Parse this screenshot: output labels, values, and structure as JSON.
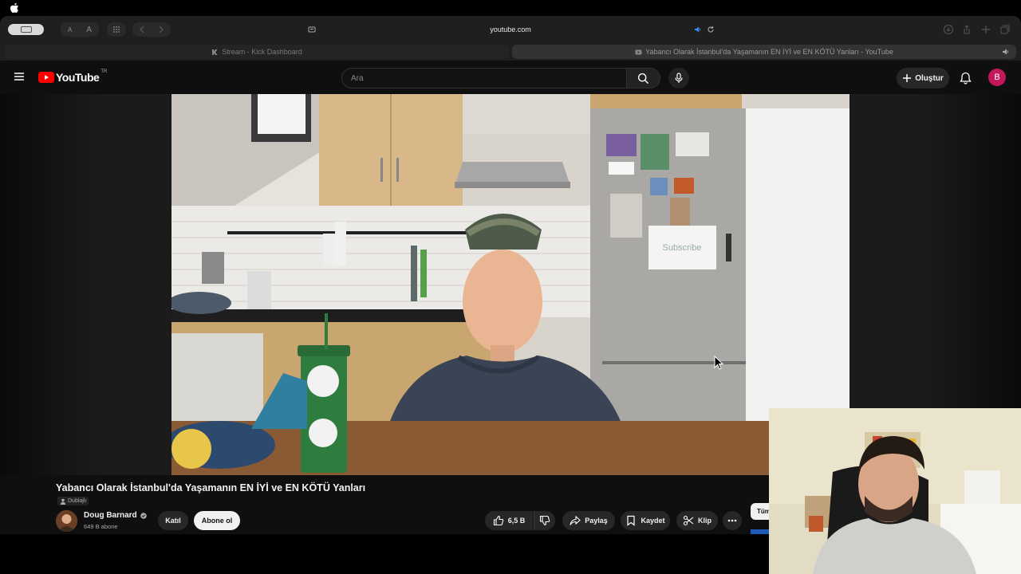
{
  "browser": {
    "url": "youtube.com",
    "tabs": [
      {
        "label": "Stream - Kick Dashboard",
        "active": false
      },
      {
        "label": "Yabancı Olarak İstanbul'da Yaşamanın EN İYİ ve EN KÖTÜ Yanları - YouTube",
        "active": true
      }
    ],
    "font_small": "A",
    "font_large": "A"
  },
  "youtube": {
    "logo_text": "YouTube",
    "country_code": "TR",
    "search_placeholder": "Ara",
    "create_label": "Oluştur",
    "avatar_letter": "B",
    "accent_color": "#ff0000"
  },
  "video": {
    "title": "Yabancı Olarak İstanbul'da Yaşamanın EN İYİ ve EN KÖTÜ Yanları",
    "badge": "Dublajlı",
    "whiteboard_text": "Subscribe"
  },
  "channel": {
    "name": "Doug Barnard",
    "subscribers": "649 B abone",
    "join_label": "Katıl",
    "subscribe_label": "Abone ol"
  },
  "actions": {
    "likes": "6,5 B",
    "share_label": "Paylaş",
    "save_label": "Kaydet",
    "clip_label": "Klip"
  },
  "sidebar": {
    "chip_label": "Tüm"
  }
}
